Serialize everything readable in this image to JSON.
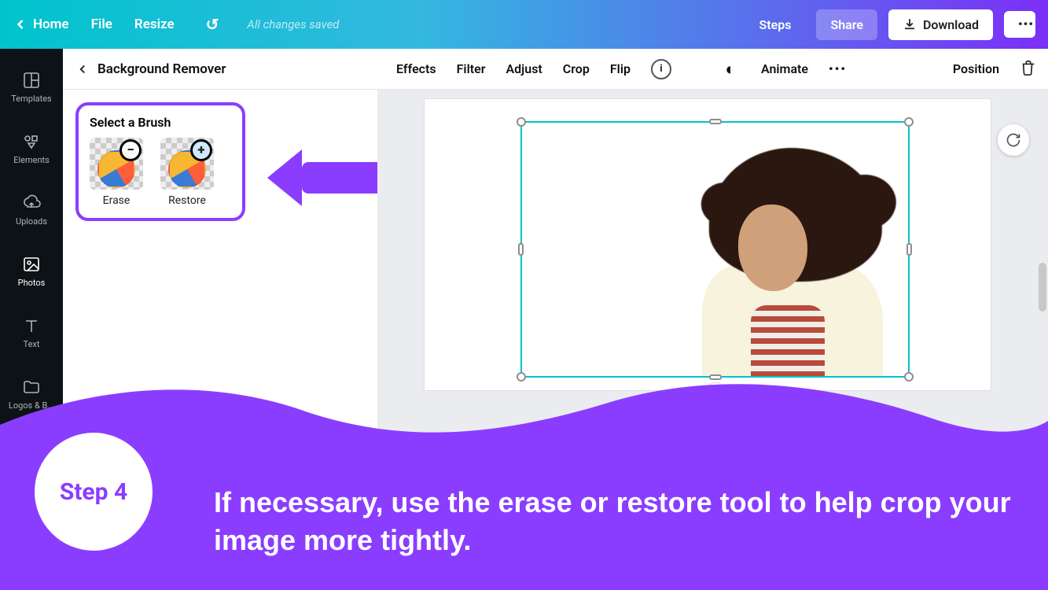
{
  "topbar": {
    "home": "Home",
    "file": "File",
    "resize": "Resize",
    "save_status": "All changes saved",
    "right": {
      "steps": "Steps",
      "share": "Share",
      "download": "Download",
      "more": "•••"
    }
  },
  "rail": [
    {
      "id": "templates",
      "label": "Templates"
    },
    {
      "id": "elements",
      "label": "Elements"
    },
    {
      "id": "uploads",
      "label": "Uploads"
    },
    {
      "id": "photos",
      "label": "Photos"
    },
    {
      "id": "text",
      "label": "Text"
    },
    {
      "id": "logos",
      "label": "Logos & B..."
    }
  ],
  "panel": {
    "title": "Background Remover",
    "brush_title": "Select a Brush",
    "erase": "Erase",
    "restore": "Restore"
  },
  "context": {
    "effects": "Effects",
    "filter": "Filter",
    "adjust": "Adjust",
    "crop": "Crop",
    "flip": "Flip",
    "info": "i",
    "transparency": "◐",
    "animate": "Animate",
    "more": "•••",
    "position": "Position"
  },
  "overlay": {
    "step_label": "Step 4",
    "instruction": "If necessary, use the erase or restore tool to help crop your image more tightly."
  },
  "colors": {
    "accent": "#8b3dff",
    "selection": "#00c4cc"
  }
}
